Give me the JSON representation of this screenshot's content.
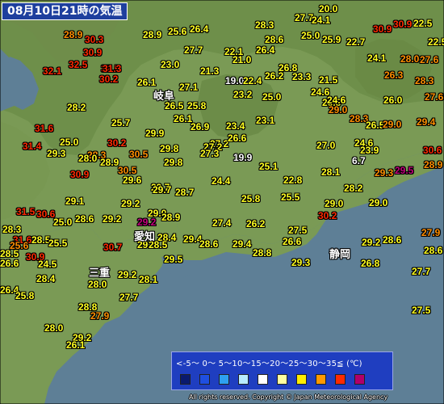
{
  "title": "08月10日21時の気温",
  "cities": {
    "gifu": "岐阜",
    "aichi": "愛知",
    "mie": "三重",
    "shizuoka": "静岡"
  },
  "legend": {
    "scale": "<-5〜 0〜 5〜10〜15〜20〜25〜30〜35≦ (℃)",
    "swatches": [
      "#0a1a6e",
      "#1f4fe0",
      "#2ea0f0",
      "#b8ecff",
      "#ffffff",
      "#ffffa0",
      "#ffee00",
      "#ff9900",
      "#ff2a00",
      "#b0006a"
    ]
  },
  "copyright": "All rights reserved. Copyright © Japan Meteorological Agency",
  "colors": {
    "sea": "#5e7f96",
    "land": "#7a9a55",
    "highland": "#6e8f4a"
  },
  "temperatures": [
    {
      "v": "28.3",
      "c": "y"
    },
    {
      "v": "27.7",
      "c": "y"
    },
    {
      "v": "20.0",
      "c": "y"
    },
    {
      "v": "30.9",
      "c": "r"
    },
    {
      "v": "28.9",
      "c": "o"
    },
    {
      "v": "28.9",
      "c": "y"
    },
    {
      "v": "25.6",
      "c": "y"
    },
    {
      "v": "26.4",
      "c": "y"
    },
    {
      "v": "28.6",
      "c": "y"
    },
    {
      "v": "25.0",
      "c": "y"
    },
    {
      "v": "25.9",
      "c": "y"
    },
    {
      "v": "22.7",
      "c": "y"
    },
    {
      "v": "24.1",
      "c": "y"
    },
    {
      "v": "30.9",
      "c": "r"
    },
    {
      "v": "22.5",
      "c": "y"
    },
    {
      "v": "30.3",
      "c": "r"
    },
    {
      "v": "22.5",
      "c": "y"
    },
    {
      "v": "26.4",
      "c": "y"
    },
    {
      "v": "22.1",
      "c": "y"
    },
    {
      "v": "30.9",
      "c": "r"
    },
    {
      "v": "32.5",
      "c": "r"
    },
    {
      "v": "27.7",
      "c": "y"
    },
    {
      "v": "21.0",
      "c": "y"
    },
    {
      "v": "24.1",
      "c": "y"
    },
    {
      "v": "28.0",
      "c": "o"
    },
    {
      "v": "27.6",
      "c": "o"
    },
    {
      "v": "32.5",
      "c": "r"
    },
    {
      "v": "23.0",
      "c": "y"
    },
    {
      "v": "26.8",
      "c": "y"
    },
    {
      "v": "32.1",
      "c": "r"
    },
    {
      "v": "31.3",
      "c": "r"
    },
    {
      "v": "21.3",
      "c": "y"
    },
    {
      "v": "26.2",
      "c": "y"
    },
    {
      "v": "23.3",
      "c": "y"
    },
    {
      "v": "26.3",
      "c": "o"
    },
    {
      "v": "30.2",
      "c": "r"
    },
    {
      "v": "19.0",
      "c": "w"
    },
    {
      "v": "22.4",
      "c": "y"
    },
    {
      "v": "21.5",
      "c": "y"
    },
    {
      "v": "28.3",
      "c": "o"
    },
    {
      "v": "26.1",
      "c": "y"
    },
    {
      "v": "27.1",
      "c": "y"
    },
    {
      "v": "24.6",
      "c": "y"
    },
    {
      "v": "23.2",
      "c": "y"
    },
    {
      "v": "25.0",
      "c": "y"
    },
    {
      "v": "26.0",
      "c": "y"
    },
    {
      "v": "27.6",
      "c": "o"
    },
    {
      "v": "28.2",
      "c": "y"
    },
    {
      "v": "26.5",
      "c": "y"
    },
    {
      "v": "25.8",
      "c": "y"
    },
    {
      "v": "26.5",
      "c": "y"
    },
    {
      "v": "24.6",
      "c": "y"
    },
    {
      "v": "29.0",
      "c": "o"
    },
    {
      "v": "29.4",
      "c": "o"
    },
    {
      "v": "28.3",
      "c": "o"
    },
    {
      "v": "23.1",
      "c": "y"
    },
    {
      "v": "26.1",
      "c": "y"
    },
    {
      "v": "31.6",
      "c": "r"
    },
    {
      "v": "25.7",
      "c": "y"
    },
    {
      "v": "26.9",
      "c": "y"
    },
    {
      "v": "23.4",
      "c": "y"
    },
    {
      "v": "26.5",
      "c": "y"
    },
    {
      "v": "29.0",
      "c": "o"
    },
    {
      "v": "27.2",
      "c": "y"
    },
    {
      "v": "29.9",
      "c": "y"
    },
    {
      "v": "26.6",
      "c": "y"
    },
    {
      "v": "25.0",
      "c": "y"
    },
    {
      "v": "24.6",
      "c": "y"
    },
    {
      "v": "31.4",
      "c": "r"
    },
    {
      "v": "30.2",
      "c": "r"
    },
    {
      "v": "27.2",
      "c": "y"
    },
    {
      "v": "27.0",
      "c": "y"
    },
    {
      "v": "23.9",
      "c": "y"
    },
    {
      "v": "30.6",
      "c": "r"
    },
    {
      "v": "29.8",
      "c": "y"
    },
    {
      "v": "27.3",
      "c": "y"
    },
    {
      "v": "29.3",
      "c": "y"
    },
    {
      "v": "30.5",
      "c": "o"
    },
    {
      "v": "28.3",
      "c": "o"
    },
    {
      "v": "28.0",
      "c": "y"
    },
    {
      "v": "6.7",
      "c": "w"
    },
    {
      "v": "28.9",
      "c": "y"
    },
    {
      "v": "29.8",
      "c": "y"
    },
    {
      "v": "19.9",
      "c": "w"
    },
    {
      "v": "25.1",
      "c": "y"
    },
    {
      "v": "28.9",
      "c": "o"
    },
    {
      "v": "28.1",
      "c": "y"
    },
    {
      "v": "29.5",
      "c": "m"
    },
    {
      "v": "29.3",
      "c": "o"
    },
    {
      "v": "30.5",
      "c": "o"
    },
    {
      "v": "29.7",
      "c": "y"
    },
    {
      "v": "30.9",
      "c": "r"
    },
    {
      "v": "29.6",
      "c": "y"
    },
    {
      "v": "24.4",
      "c": "y"
    },
    {
      "v": "22.8",
      "c": "y"
    },
    {
      "v": "28.2",
      "c": "y"
    },
    {
      "v": "28.7",
      "c": "y"
    },
    {
      "v": "29.7",
      "c": "y"
    },
    {
      "v": "25.5",
      "c": "y"
    },
    {
      "v": "29.1",
      "c": "y"
    },
    {
      "v": "29.2",
      "c": "y"
    },
    {
      "v": "25.8",
      "c": "y"
    },
    {
      "v": "29.0",
      "c": "y"
    },
    {
      "v": "29.0",
      "c": "y"
    },
    {
      "v": "31.5",
      "c": "r"
    },
    {
      "v": "30.6",
      "c": "r"
    },
    {
      "v": "29.0",
      "c": "y"
    },
    {
      "v": "25.0",
      "c": "y"
    },
    {
      "v": "28.6",
      "c": "y"
    },
    {
      "v": "29.2",
      "c": "y"
    },
    {
      "v": "28.9",
      "c": "y"
    },
    {
      "v": "27.4",
      "c": "y"
    },
    {
      "v": "26.2",
      "c": "y"
    },
    {
      "v": "30.2",
      "c": "r"
    },
    {
      "v": "29.2",
      "c": "m"
    },
    {
      "v": "27.9",
      "c": "o"
    },
    {
      "v": "28.3",
      "c": "y"
    },
    {
      "v": "29.4",
      "c": "y"
    },
    {
      "v": "29.2",
      "c": "y"
    },
    {
      "v": "27.5",
      "c": "y"
    },
    {
      "v": "31.6",
      "c": "r"
    },
    {
      "v": "28.5",
      "c": "y"
    },
    {
      "v": "28.4",
      "c": "y"
    },
    {
      "v": "29.4",
      "c": "y"
    },
    {
      "v": "26.6",
      "c": "y"
    },
    {
      "v": "28.6",
      "c": "y"
    },
    {
      "v": "29.2",
      "c": "y"
    },
    {
      "v": "28.6",
      "c": "y"
    },
    {
      "v": "25.5",
      "c": "y"
    },
    {
      "v": "30.7",
      "c": "r"
    },
    {
      "v": "28.5",
      "c": "y"
    },
    {
      "v": "28.8",
      "c": "y"
    },
    {
      "v": "30.9",
      "c": "r"
    },
    {
      "v": "25.6",
      "c": "o"
    },
    {
      "v": "24.5",
      "c": "y"
    },
    {
      "v": "28.6",
      "c": "y"
    },
    {
      "v": "28.5",
      "c": "y"
    },
    {
      "v": "27.7",
      "c": "y"
    },
    {
      "v": "26.6",
      "c": "y"
    },
    {
      "v": "29.5",
      "c": "y"
    },
    {
      "v": "29.3",
      "c": "y"
    },
    {
      "v": "26.8",
      "c": "y"
    },
    {
      "v": "28.4",
      "c": "y"
    },
    {
      "v": "29.2",
      "c": "y"
    },
    {
      "v": "28.1",
      "c": "y"
    },
    {
      "v": "28.0",
      "c": "y"
    },
    {
      "v": "26.4",
      "c": "y"
    },
    {
      "v": "27.7",
      "c": "y"
    },
    {
      "v": "25.8",
      "c": "y"
    },
    {
      "v": "27.5",
      "c": "y"
    },
    {
      "v": "28.8",
      "c": "y"
    },
    {
      "v": "27.9",
      "c": "o"
    },
    {
      "v": "28.0",
      "c": "y"
    },
    {
      "v": "29.2",
      "c": "y"
    },
    {
      "v": "26.1",
      "c": "y"
    }
  ]
}
